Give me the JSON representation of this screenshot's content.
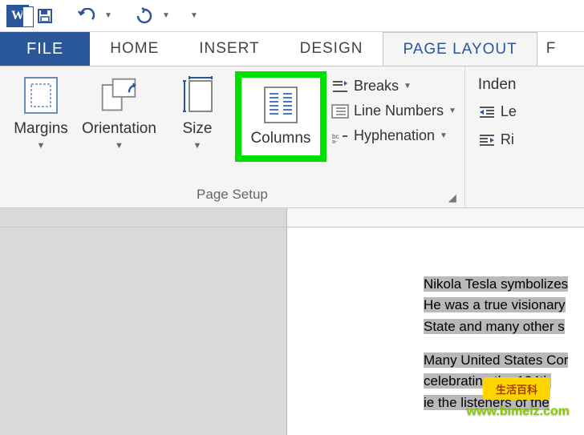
{
  "titlebar": {
    "save_tip": "Save",
    "undo_tip": "Undo",
    "redo_tip": "Redo"
  },
  "tabs": {
    "file": "FILE",
    "home": "HOME",
    "insert": "INSERT",
    "design": "DESIGN",
    "page_layout": "PAGE LAYOUT",
    "partial": "F"
  },
  "ribbon": {
    "margins": "Margins",
    "orientation": "Orientation",
    "size": "Size",
    "columns": "Columns",
    "breaks": "Breaks",
    "line_numbers": "Line Numbers",
    "hyphenation": "Hyphenation",
    "page_setup": "Page Setup",
    "indent": "Inden",
    "left": "Le",
    "right": "Ri"
  },
  "document": {
    "p1a": "Nikola Tesla symbolizes",
    "p1b": "He was a true visionary",
    "p1c": "State and many other s",
    "p2a": "Many United States Cor",
    "p2b": "celebrating the 134th",
    "p2c": "ie the listeners of the"
  },
  "watermark": {
    "badge": "生活百科",
    "url": "www.bimeiz.com"
  }
}
